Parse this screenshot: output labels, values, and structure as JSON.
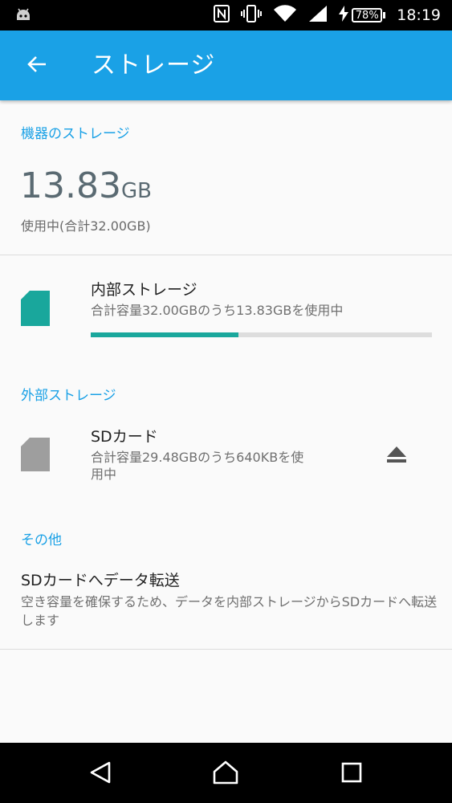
{
  "status_bar": {
    "battery": "78%",
    "time": "18:19",
    "icons": [
      "android-debug-icon",
      "nfc-icon",
      "vibrate-icon",
      "wifi-icon",
      "signal-icon",
      "charging-icon",
      "battery-icon"
    ]
  },
  "app_bar": {
    "title": "ストレージ",
    "back_icon": "arrow-left-icon",
    "color": "#1aa1e6"
  },
  "device_storage": {
    "header": "機器のストレージ",
    "used_value": "13.83",
    "used_unit": "GB",
    "used_label": "使用中(合計32.00GB)"
  },
  "internal_storage": {
    "title": "内部ストレージ",
    "subtitle": "合計容量32.00GBのうち13.83GBを使用中",
    "progress_fraction": 0.432,
    "icon": "internal-storage-icon",
    "color": "#19a79c"
  },
  "external_storage": {
    "header": "外部ストレージ",
    "sd_title": "SDカード",
    "sd_subtitle_line1": "合計容量29.48GBのうち640KBを使",
    "sd_subtitle_line2": "用中",
    "icon": "sd-card-icon",
    "eject_icon": "eject-icon"
  },
  "other": {
    "header": "その他",
    "transfer_title": "SDカードへデータ転送",
    "transfer_desc": "空き容量を確保するため、データを内部ストレージからSDカードへ転送します"
  },
  "nav_bar": {
    "icons": [
      "back-triangle-icon",
      "home-icon",
      "recents-icon"
    ]
  }
}
